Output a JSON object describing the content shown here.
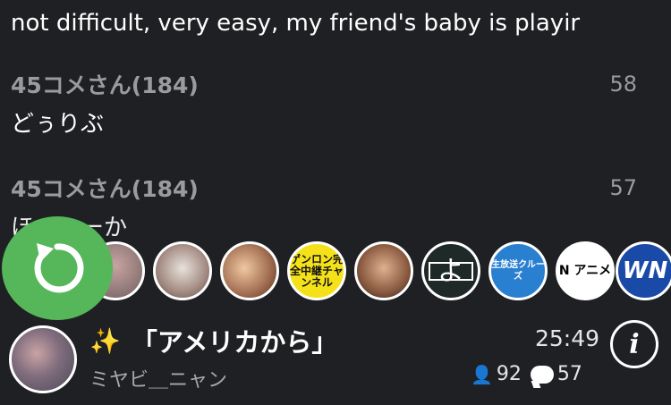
{
  "comments_area": {
    "top_text": "not difficult, very easy, my friend's baby is playir",
    "comments": [
      {
        "author": "45コメさん(184)",
        "number": "58",
        "text": "どぅりぶ"
      },
      {
        "author": "45コメさん(184)",
        "number": "57",
        "text": "ほーーーか"
      }
    ]
  },
  "channel_rail": {
    "channels": [
      {
        "name": "channel-1",
        "label": ""
      },
      {
        "name": "channel-2",
        "label": ""
      },
      {
        "name": "channel-3",
        "label": ""
      },
      {
        "name": "channel-4",
        "label": "ゲンロン完全中継チャンネル"
      },
      {
        "name": "channel-5",
        "label": ""
      },
      {
        "name": "channel-6",
        "label": "よ"
      },
      {
        "name": "channel-7",
        "label": "生放送クルーズ"
      },
      {
        "name": "channel-8",
        "label": "N アニメ"
      },
      {
        "name": "channel-9",
        "label": "WN"
      }
    ]
  },
  "now_playing": {
    "title": "「アメリカから」",
    "user": "ミヤビ＿ニャン",
    "time": "25:49",
    "viewers": "92",
    "comments": "57"
  }
}
